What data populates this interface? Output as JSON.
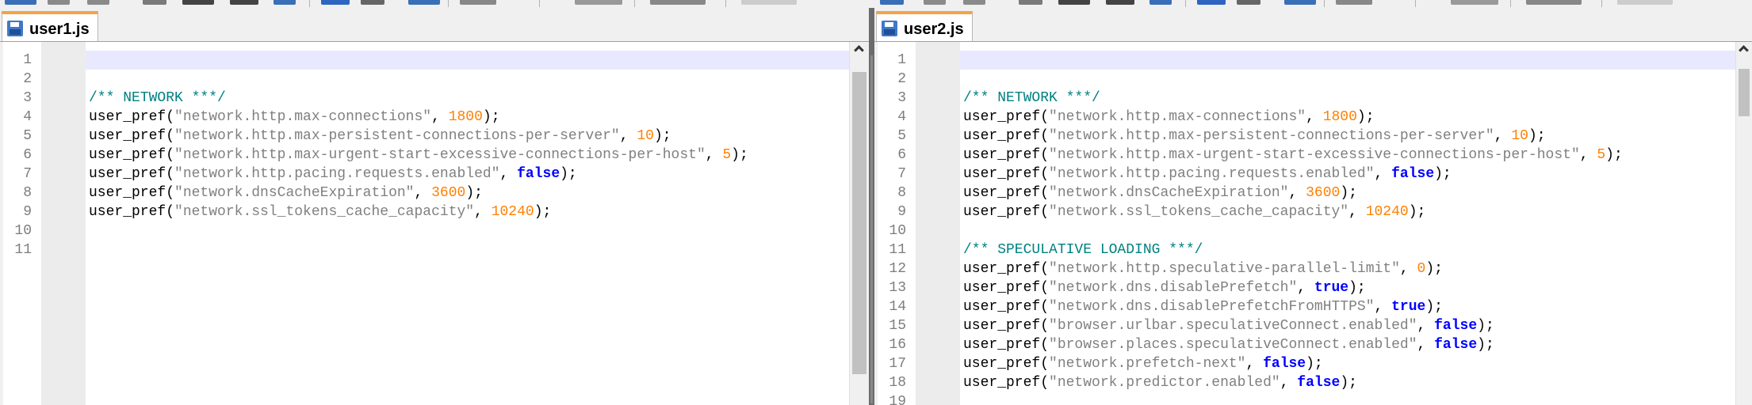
{
  "colors": {
    "tab_accent": "#f4a347",
    "comment": "#008080",
    "string": "#808080",
    "number": "#ff8000",
    "keyword": "#0000ff",
    "current_line": "#e8e8ff"
  },
  "left": {
    "tab_label": "user1.js",
    "tab_icon": "floppy-disk-icon",
    "lines": [
      [],
      [],
      [
        {
          "t": "/** NETWORK ***/",
          "c": "comment"
        }
      ],
      [
        {
          "t": "user_pref("
        },
        {
          "t": "\"network.http.max-connections\"",
          "c": "str"
        },
        {
          "t": ", "
        },
        {
          "t": "1800",
          "c": "num"
        },
        {
          "t": ");"
        }
      ],
      [
        {
          "t": "user_pref("
        },
        {
          "t": "\"network.http.max-persistent-connections-per-server\"",
          "c": "str"
        },
        {
          "t": ", "
        },
        {
          "t": "10",
          "c": "num"
        },
        {
          "t": ");"
        }
      ],
      [
        {
          "t": "user_pref("
        },
        {
          "t": "\"network.http.max-urgent-start-excessive-connections-per-host\"",
          "c": "str"
        },
        {
          "t": ", "
        },
        {
          "t": "5",
          "c": "num"
        },
        {
          "t": ");"
        }
      ],
      [
        {
          "t": "user_pref("
        },
        {
          "t": "\"network.http.pacing.requests.enabled\"",
          "c": "str"
        },
        {
          "t": ", "
        },
        {
          "t": "false",
          "c": "kw"
        },
        {
          "t": ");"
        }
      ],
      [
        {
          "t": "user_pref("
        },
        {
          "t": "\"network.dnsCacheExpiration\"",
          "c": "str"
        },
        {
          "t": ", "
        },
        {
          "t": "3600",
          "c": "num"
        },
        {
          "t": ");"
        }
      ],
      [
        {
          "t": "user_pref("
        },
        {
          "t": "\"network.ssl_tokens_cache_capacity\"",
          "c": "str"
        },
        {
          "t": ", "
        },
        {
          "t": "10240",
          "c": "num"
        },
        {
          "t": ");"
        }
      ],
      [],
      []
    ]
  },
  "right": {
    "tab_label": "user2.js",
    "tab_icon": "floppy-disk-icon",
    "lines": [
      [],
      [],
      [
        {
          "t": "/** NETWORK ***/",
          "c": "comment"
        }
      ],
      [
        {
          "t": "user_pref("
        },
        {
          "t": "\"network.http.max-connections\"",
          "c": "str"
        },
        {
          "t": ", "
        },
        {
          "t": "1800",
          "c": "num"
        },
        {
          "t": ");"
        }
      ],
      [
        {
          "t": "user_pref("
        },
        {
          "t": "\"network.http.max-persistent-connections-per-server\"",
          "c": "str"
        },
        {
          "t": ", "
        },
        {
          "t": "10",
          "c": "num"
        },
        {
          "t": ");"
        }
      ],
      [
        {
          "t": "user_pref("
        },
        {
          "t": "\"network.http.max-urgent-start-excessive-connections-per-host\"",
          "c": "str"
        },
        {
          "t": ", "
        },
        {
          "t": "5",
          "c": "num"
        },
        {
          "t": ");"
        }
      ],
      [
        {
          "t": "user_pref("
        },
        {
          "t": "\"network.http.pacing.requests.enabled\"",
          "c": "str"
        },
        {
          "t": ", "
        },
        {
          "t": "false",
          "c": "kw"
        },
        {
          "t": ");"
        }
      ],
      [
        {
          "t": "user_pref("
        },
        {
          "t": "\"network.dnsCacheExpiration\"",
          "c": "str"
        },
        {
          "t": ", "
        },
        {
          "t": "3600",
          "c": "num"
        },
        {
          "t": ");"
        }
      ],
      [
        {
          "t": "user_pref("
        },
        {
          "t": "\"network.ssl_tokens_cache_capacity\"",
          "c": "str"
        },
        {
          "t": ", "
        },
        {
          "t": "10240",
          "c": "num"
        },
        {
          "t": ");"
        }
      ],
      [],
      [
        {
          "t": "/** SPECULATIVE LOADING ***/",
          "c": "comment"
        }
      ],
      [
        {
          "t": "user_pref("
        },
        {
          "t": "\"network.http.speculative-parallel-limit\"",
          "c": "str"
        },
        {
          "t": ", "
        },
        {
          "t": "0",
          "c": "num"
        },
        {
          "t": ");"
        }
      ],
      [
        {
          "t": "user_pref("
        },
        {
          "t": "\"network.dns.disablePrefetch\"",
          "c": "str"
        },
        {
          "t": ", "
        },
        {
          "t": "true",
          "c": "kw"
        },
        {
          "t": ");"
        }
      ],
      [
        {
          "t": "user_pref("
        },
        {
          "t": "\"network.dns.disablePrefetchFromHTTPS\"",
          "c": "str"
        },
        {
          "t": ", "
        },
        {
          "t": "true",
          "c": "kw"
        },
        {
          "t": ");"
        }
      ],
      [
        {
          "t": "user_pref("
        },
        {
          "t": "\"browser.urlbar.speculativeConnect.enabled\"",
          "c": "str"
        },
        {
          "t": ", "
        },
        {
          "t": "false",
          "c": "kw"
        },
        {
          "t": ");"
        }
      ],
      [
        {
          "t": "user_pref("
        },
        {
          "t": "\"browser.places.speculativeConnect.enabled\"",
          "c": "str"
        },
        {
          "t": ", "
        },
        {
          "t": "false",
          "c": "kw"
        },
        {
          "t": ");"
        }
      ],
      [
        {
          "t": "user_pref("
        },
        {
          "t": "\"network.prefetch-next\"",
          "c": "str"
        },
        {
          "t": ", "
        },
        {
          "t": "false",
          "c": "kw"
        },
        {
          "t": ");"
        }
      ],
      [
        {
          "t": "user_pref("
        },
        {
          "t": "\"network.predictor.enabled\"",
          "c": "str"
        },
        {
          "t": ", "
        },
        {
          "t": "false",
          "c": "kw"
        },
        {
          "t": ");"
        }
      ],
      []
    ]
  }
}
